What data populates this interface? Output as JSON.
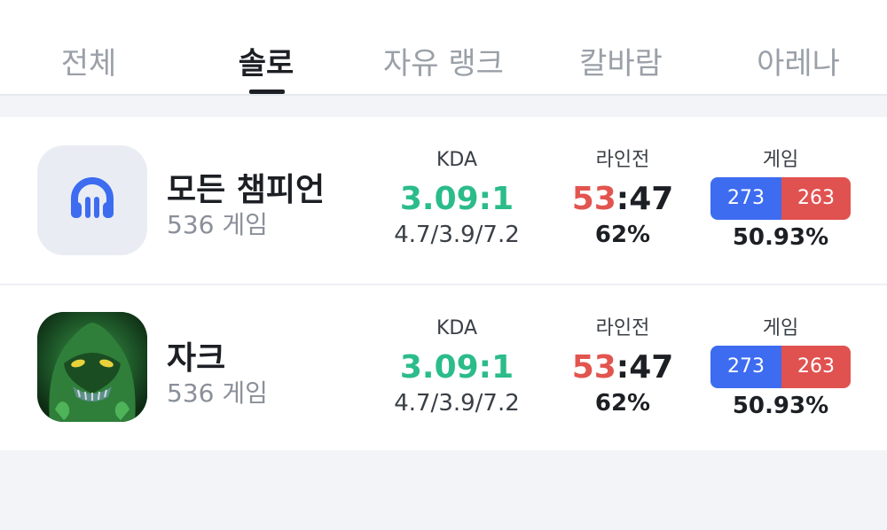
{
  "tabs": [
    {
      "label": "전체",
      "active": false
    },
    {
      "label": "솔로",
      "active": true
    },
    {
      "label": "자유 랭크",
      "active": false
    },
    {
      "label": "칼바람",
      "active": false
    },
    {
      "label": "아레나",
      "active": false
    }
  ],
  "colors": {
    "kda": "#2bbc8a",
    "lane_win": "#e2554f",
    "wins_bar": "#3d6cf0",
    "losses_bar": "#e05250",
    "active_tab": "#1c1f24",
    "inactive_tab": "#9aa0a8"
  },
  "rows": [
    {
      "icon": "headset-icon",
      "name": "모든 챔피언",
      "games": "536 게임",
      "kda_label": "KDA",
      "kda_ratio": "3.09:1",
      "kda_detail": "4.7/3.9/7.2",
      "lane_label": "라인전",
      "lane_win": "53",
      "lane_sep": ":",
      "lane_loss": "47",
      "lane_pct": "62%",
      "game_label": "게임",
      "wins": "273",
      "losses": "263",
      "win_rate": "50.93%"
    },
    {
      "icon": "zac-champion-icon",
      "name": "자크",
      "games": "536 게임",
      "kda_label": "KDA",
      "kda_ratio": "3.09:1",
      "kda_detail": "4.7/3.9/7.2",
      "lane_label": "라인전",
      "lane_win": "53",
      "lane_sep": ":",
      "lane_loss": "47",
      "lane_pct": "62%",
      "game_label": "게임",
      "wins": "273",
      "losses": "263",
      "win_rate": "50.93%"
    }
  ]
}
